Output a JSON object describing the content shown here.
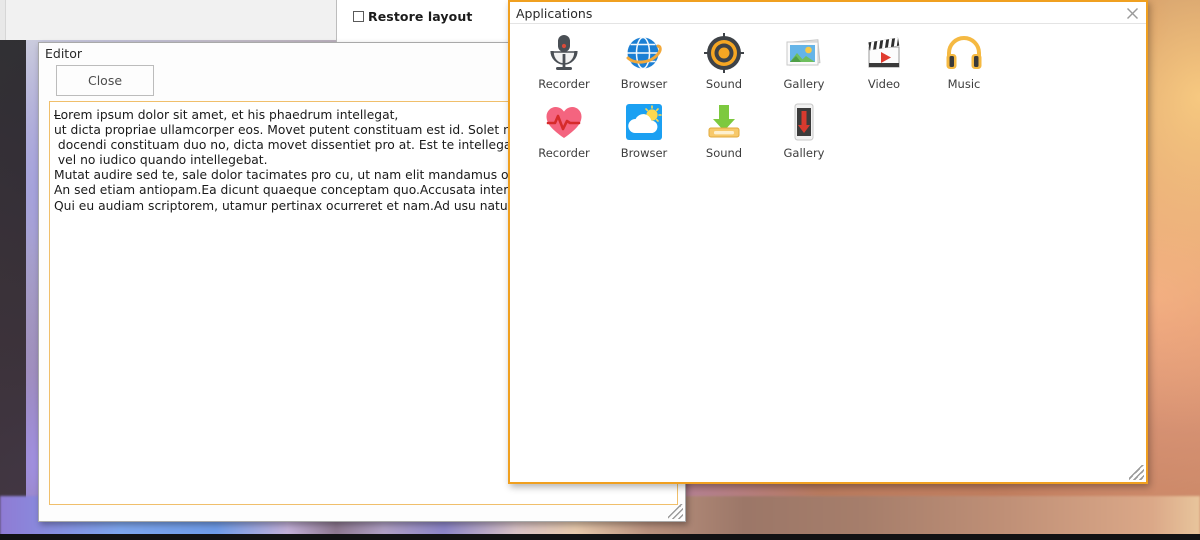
{
  "desktop": {
    "wallpaper_name": "blurred-gradient-wallpaper",
    "colors": {
      "accent_orange": "#f0a020",
      "editor_field_border": "#f0bf6b",
      "window_border_gray": "#a9a9a9"
    }
  },
  "background_dialog": {
    "restore_layout": {
      "label": "Restore layout",
      "checked": false
    }
  },
  "editor_window": {
    "title": "Editor",
    "close_button": "Close",
    "document_lines": [
      "Lorem ipsum dolor sit amet, et his phaedrum intellegat,",
      "ut dicta propriae ullamcorper eos. Movet putent constituam est id. Solet nonumy duo id",
      " docendi constituam duo no, dicta movet dissentiet pro at. Est te intellegat delicatissimi",
      " vel no iudico quando intellegebat.",
      "Mutat audire sed te, sale dolor tacimates pro cu, ut nam elit mandamus oportere.",
      "An sed etiam antiopam.Ea dicunt quaeque conceptam quo.Accusata interpretaris mei eu",
      "Qui eu audiam scriptorem, utamur pertinax ocurreret et nam.Ad usu natum interesset, e"
    ],
    "resize_handle": "resize-grip"
  },
  "applications_window": {
    "title": "Applications",
    "close_icon": "close-icon",
    "resize_handle": "resize-grip",
    "rows": [
      [
        {
          "label": "Recorder",
          "icon": "microphone-icon"
        },
        {
          "label": "Browser",
          "icon": "globe-icon"
        },
        {
          "label": "Sound",
          "icon": "speaker-icon"
        },
        {
          "label": "Gallery",
          "icon": "photos-icon"
        },
        {
          "label": "Video",
          "icon": "clapperboard-icon"
        },
        {
          "label": "Music",
          "icon": "headphones-icon"
        }
      ],
      [
        {
          "label": "Recorder",
          "icon": "heart-pulse-icon"
        },
        {
          "label": "Browser",
          "icon": "weather-cloud-sun-icon"
        },
        {
          "label": "Sound",
          "icon": "download-tray-icon"
        },
        {
          "label": "Gallery",
          "icon": "phone-download-icon"
        }
      ]
    ]
  }
}
